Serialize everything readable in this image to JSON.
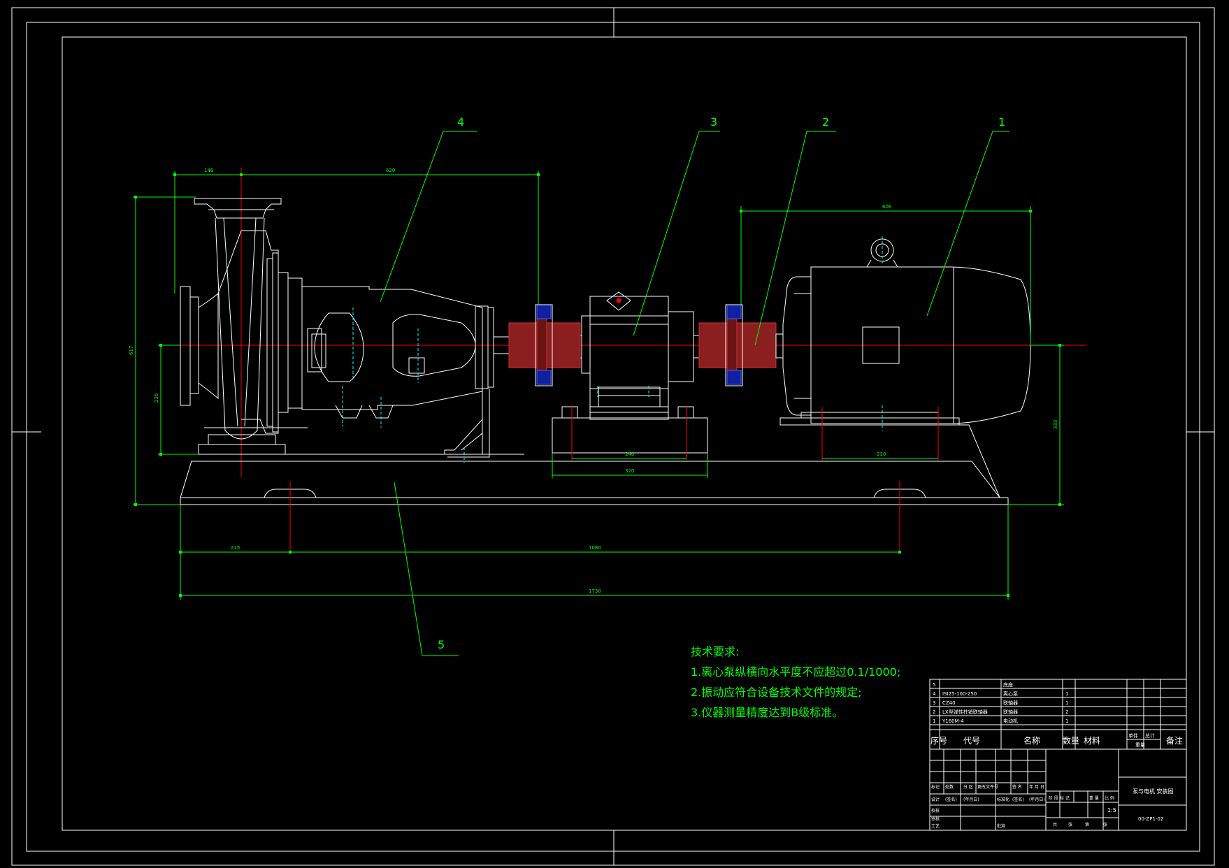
{
  "sheet": {
    "line_color": "#ffffff",
    "dim_color": "#00ff00",
    "center_color": "#ff0000",
    "hidden_color": "#00ffff",
    "part_color": "#d23232"
  },
  "callouts": [
    "4",
    "3",
    "2",
    "1",
    "5"
  ],
  "dimensions": {
    "d146": "146",
    "d620": "620",
    "d606": "606",
    "d617": "617",
    "d235": "235",
    "d333": "333",
    "d240": "240",
    "d320": "320",
    "d210": "210",
    "d225": "225",
    "d1080": "1080",
    "d1730": "1730"
  },
  "tech_requirements": {
    "title": "技术要求:",
    "items": [
      "1.离心泵纵横向水平度不应超过0.1/1000;",
      "2.振动应符合设备技术文件的规定;",
      "3.仪器测量精度达到B级标准。"
    ]
  },
  "parts_list": {
    "rows": [
      {
        "no": "5",
        "code": "",
        "name": "底座",
        "qty": ""
      },
      {
        "no": "4",
        "code": "ISI25-100-250",
        "name": "离心泵",
        "qty": "1"
      },
      {
        "no": "3",
        "code": "CZ40",
        "name": "联轴器",
        "qty": "1"
      },
      {
        "no": "2",
        "code": "LX型弹性柱销联轴器",
        "name": "联轴器",
        "qty": "2"
      },
      {
        "no": "1",
        "code": "Y160M-4",
        "name": "电动机",
        "qty": "1"
      }
    ],
    "headers": {
      "no": "序号",
      "code": "代号",
      "name": "名称",
      "qty": "数量",
      "material": "材料",
      "unit_weight": "单件",
      "total_weight": "总计",
      "weight": "重量",
      "remark": "备注"
    }
  },
  "title_block": {
    "title": "泵与电机 安装图",
    "drawing_no": "00-ZP1-02",
    "scale": "1:5",
    "sign_row_labels": [
      "标记",
      "处数",
      "分 区",
      "更改文件号",
      "签 名",
      "年 月 日"
    ],
    "roles": [
      "设计",
      "校核",
      "审核",
      "工艺",
      "批准"
    ],
    "signature_marks": [
      "(签名)",
      "(年月日)",
      "标准化",
      "(签名)",
      "(年月日)"
    ],
    "stage_labels": [
      "阶 段 标 记",
      "重 量",
      "比 例"
    ],
    "sheet_labels": [
      "共",
      "张",
      "第",
      "张"
    ]
  }
}
